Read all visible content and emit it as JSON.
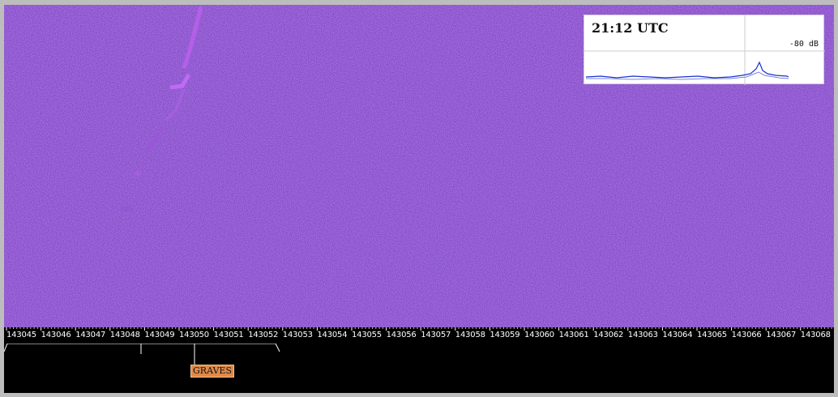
{
  "spectrum": {
    "utc_time": "21:12 UTC",
    "db_label": "-80 dB"
  },
  "frequency_ruler": {
    "ticks": [
      "143045",
      "143046",
      "143047",
      "143048",
      "143049",
      "143050",
      "143051",
      "143052",
      "143053",
      "143054",
      "143055",
      "143056",
      "143057",
      "143058",
      "143059",
      "143060",
      "143061",
      "143062",
      "143063",
      "143064",
      "143065",
      "143066",
      "143067",
      "143068"
    ]
  },
  "markers": {
    "graves_label": "GRAVES"
  },
  "colors": {
    "waterfall_background": "#3a1a9a",
    "signal_trace": "#d070ff",
    "spectrum_line": "#1a2fd0",
    "marker_tag": "#e08a4a"
  }
}
